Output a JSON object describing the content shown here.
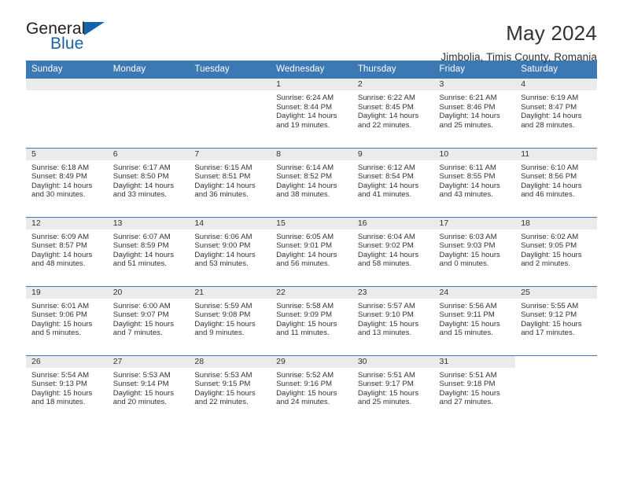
{
  "brand": {
    "name_top": "General",
    "name_bottom": "Blue",
    "accent_color": "#1464aa",
    "triangle_icon": "brand-triangle-icon"
  },
  "header": {
    "title": "May 2024",
    "subtitle": "Jimbolia, Timis County, Romania",
    "header_bg_color": "#3c78b4",
    "daynum_band_color": "#ebebeb"
  },
  "weekday_headers": [
    "Sunday",
    "Monday",
    "Tuesday",
    "Wednesday",
    "Thursday",
    "Friday",
    "Saturday"
  ],
  "labels": {
    "sunrise": "Sunrise:",
    "sunset": "Sunset:",
    "daylight": "Daylight:"
  },
  "weeks": [
    [
      {
        "day": "",
        "empty": true
      },
      {
        "day": "",
        "empty": true
      },
      {
        "day": "",
        "empty": true
      },
      {
        "day": "1",
        "sunrise": "Sunrise: 6:24 AM",
        "sunset": "Sunset: 8:44 PM",
        "daylight_line1": "Daylight: 14 hours",
        "daylight_line2": "and 19 minutes."
      },
      {
        "day": "2",
        "sunrise": "Sunrise: 6:22 AM",
        "sunset": "Sunset: 8:45 PM",
        "daylight_line1": "Daylight: 14 hours",
        "daylight_line2": "and 22 minutes."
      },
      {
        "day": "3",
        "sunrise": "Sunrise: 6:21 AM",
        "sunset": "Sunset: 8:46 PM",
        "daylight_line1": "Daylight: 14 hours",
        "daylight_line2": "and 25 minutes."
      },
      {
        "day": "4",
        "sunrise": "Sunrise: 6:19 AM",
        "sunset": "Sunset: 8:47 PM",
        "daylight_line1": "Daylight: 14 hours",
        "daylight_line2": "and 28 minutes."
      }
    ],
    [
      {
        "day": "5",
        "sunrise": "Sunrise: 6:18 AM",
        "sunset": "Sunset: 8:49 PM",
        "daylight_line1": "Daylight: 14 hours",
        "daylight_line2": "and 30 minutes."
      },
      {
        "day": "6",
        "sunrise": "Sunrise: 6:17 AM",
        "sunset": "Sunset: 8:50 PM",
        "daylight_line1": "Daylight: 14 hours",
        "daylight_line2": "and 33 minutes."
      },
      {
        "day": "7",
        "sunrise": "Sunrise: 6:15 AM",
        "sunset": "Sunset: 8:51 PM",
        "daylight_line1": "Daylight: 14 hours",
        "daylight_line2": "and 36 minutes."
      },
      {
        "day": "8",
        "sunrise": "Sunrise: 6:14 AM",
        "sunset": "Sunset: 8:52 PM",
        "daylight_line1": "Daylight: 14 hours",
        "daylight_line2": "and 38 minutes."
      },
      {
        "day": "9",
        "sunrise": "Sunrise: 6:12 AM",
        "sunset": "Sunset: 8:54 PM",
        "daylight_line1": "Daylight: 14 hours",
        "daylight_line2": "and 41 minutes."
      },
      {
        "day": "10",
        "sunrise": "Sunrise: 6:11 AM",
        "sunset": "Sunset: 8:55 PM",
        "daylight_line1": "Daylight: 14 hours",
        "daylight_line2": "and 43 minutes."
      },
      {
        "day": "11",
        "sunrise": "Sunrise: 6:10 AM",
        "sunset": "Sunset: 8:56 PM",
        "daylight_line1": "Daylight: 14 hours",
        "daylight_line2": "and 46 minutes."
      }
    ],
    [
      {
        "day": "12",
        "sunrise": "Sunrise: 6:09 AM",
        "sunset": "Sunset: 8:57 PM",
        "daylight_line1": "Daylight: 14 hours",
        "daylight_line2": "and 48 minutes."
      },
      {
        "day": "13",
        "sunrise": "Sunrise: 6:07 AM",
        "sunset": "Sunset: 8:59 PM",
        "daylight_line1": "Daylight: 14 hours",
        "daylight_line2": "and 51 minutes."
      },
      {
        "day": "14",
        "sunrise": "Sunrise: 6:06 AM",
        "sunset": "Sunset: 9:00 PM",
        "daylight_line1": "Daylight: 14 hours",
        "daylight_line2": "and 53 minutes."
      },
      {
        "day": "15",
        "sunrise": "Sunrise: 6:05 AM",
        "sunset": "Sunset: 9:01 PM",
        "daylight_line1": "Daylight: 14 hours",
        "daylight_line2": "and 56 minutes."
      },
      {
        "day": "16",
        "sunrise": "Sunrise: 6:04 AM",
        "sunset": "Sunset: 9:02 PM",
        "daylight_line1": "Daylight: 14 hours",
        "daylight_line2": "and 58 minutes."
      },
      {
        "day": "17",
        "sunrise": "Sunrise: 6:03 AM",
        "sunset": "Sunset: 9:03 PM",
        "daylight_line1": "Daylight: 15 hours",
        "daylight_line2": "and 0 minutes."
      },
      {
        "day": "18",
        "sunrise": "Sunrise: 6:02 AM",
        "sunset": "Sunset: 9:05 PM",
        "daylight_line1": "Daylight: 15 hours",
        "daylight_line2": "and 2 minutes."
      }
    ],
    [
      {
        "day": "19",
        "sunrise": "Sunrise: 6:01 AM",
        "sunset": "Sunset: 9:06 PM",
        "daylight_line1": "Daylight: 15 hours",
        "daylight_line2": "and 5 minutes."
      },
      {
        "day": "20",
        "sunrise": "Sunrise: 6:00 AM",
        "sunset": "Sunset: 9:07 PM",
        "daylight_line1": "Daylight: 15 hours",
        "daylight_line2": "and 7 minutes."
      },
      {
        "day": "21",
        "sunrise": "Sunrise: 5:59 AM",
        "sunset": "Sunset: 9:08 PM",
        "daylight_line1": "Daylight: 15 hours",
        "daylight_line2": "and 9 minutes."
      },
      {
        "day": "22",
        "sunrise": "Sunrise: 5:58 AM",
        "sunset": "Sunset: 9:09 PM",
        "daylight_line1": "Daylight: 15 hours",
        "daylight_line2": "and 11 minutes."
      },
      {
        "day": "23",
        "sunrise": "Sunrise: 5:57 AM",
        "sunset": "Sunset: 9:10 PM",
        "daylight_line1": "Daylight: 15 hours",
        "daylight_line2": "and 13 minutes."
      },
      {
        "day": "24",
        "sunrise": "Sunrise: 5:56 AM",
        "sunset": "Sunset: 9:11 PM",
        "daylight_line1": "Daylight: 15 hours",
        "daylight_line2": "and 15 minutes."
      },
      {
        "day": "25",
        "sunrise": "Sunrise: 5:55 AM",
        "sunset": "Sunset: 9:12 PM",
        "daylight_line1": "Daylight: 15 hours",
        "daylight_line2": "and 17 minutes."
      }
    ],
    [
      {
        "day": "26",
        "sunrise": "Sunrise: 5:54 AM",
        "sunset": "Sunset: 9:13 PM",
        "daylight_line1": "Daylight: 15 hours",
        "daylight_line2": "and 18 minutes."
      },
      {
        "day": "27",
        "sunrise": "Sunrise: 5:53 AM",
        "sunset": "Sunset: 9:14 PM",
        "daylight_line1": "Daylight: 15 hours",
        "daylight_line2": "and 20 minutes."
      },
      {
        "day": "28",
        "sunrise": "Sunrise: 5:53 AM",
        "sunset": "Sunset: 9:15 PM",
        "daylight_line1": "Daylight: 15 hours",
        "daylight_line2": "and 22 minutes."
      },
      {
        "day": "29",
        "sunrise": "Sunrise: 5:52 AM",
        "sunset": "Sunset: 9:16 PM",
        "daylight_line1": "Daylight: 15 hours",
        "daylight_line2": "and 24 minutes."
      },
      {
        "day": "30",
        "sunrise": "Sunrise: 5:51 AM",
        "sunset": "Sunset: 9:17 PM",
        "daylight_line1": "Daylight: 15 hours",
        "daylight_line2": "and 25 minutes."
      },
      {
        "day": "31",
        "sunrise": "Sunrise: 5:51 AM",
        "sunset": "Sunset: 9:18 PM",
        "daylight_line1": "Daylight: 15 hours",
        "daylight_line2": "and 27 minutes."
      },
      {
        "day": "",
        "empty": true,
        "blank": true
      }
    ]
  ]
}
